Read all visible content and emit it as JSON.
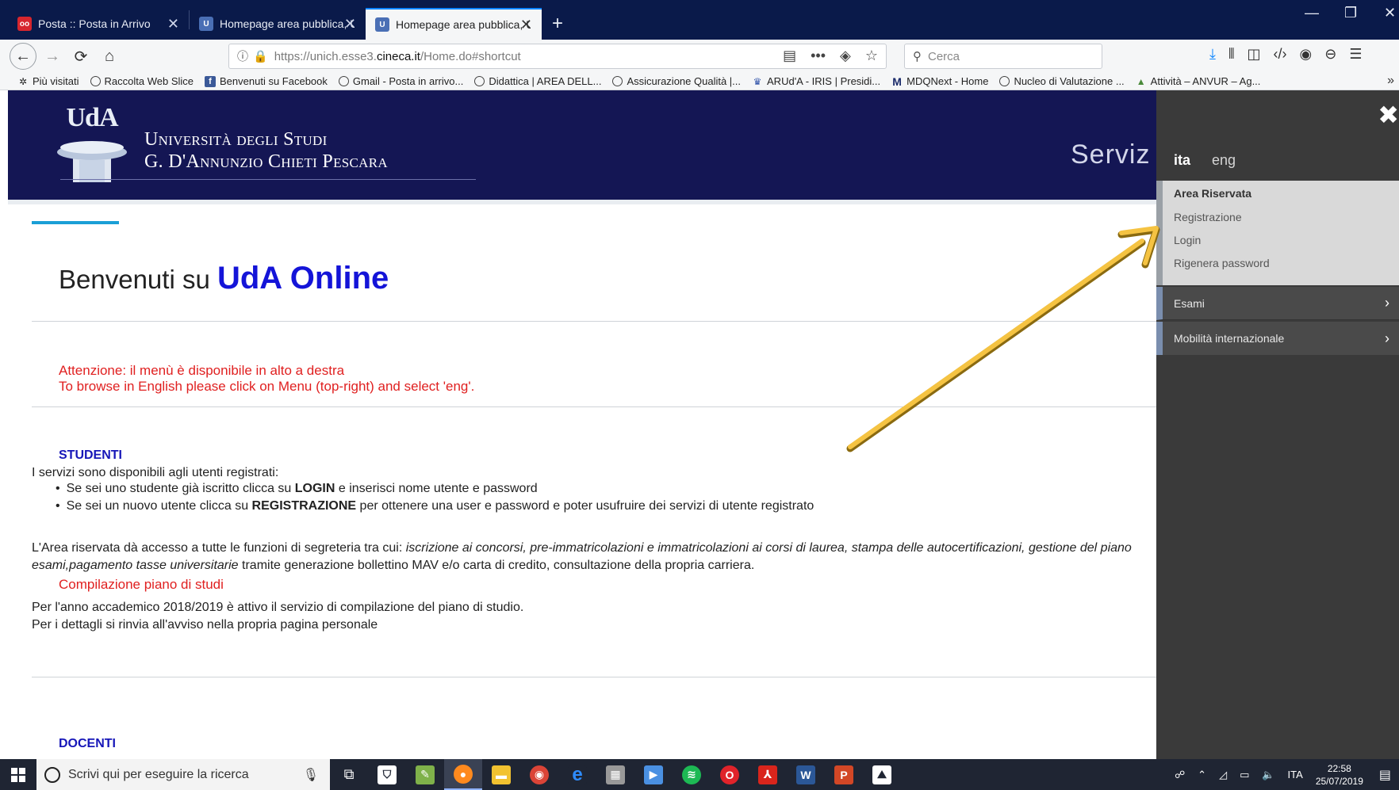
{
  "browser": {
    "tabs": [
      {
        "title": "Posta :: Posta in Arrivo",
        "active": false
      },
      {
        "title": "Homepage area pubblica, Univ",
        "active": false
      },
      {
        "title": "Homepage area pubblica, Univ",
        "active": true
      }
    ],
    "new_tab": "+",
    "url": {
      "prefix": "https://unich.esse3.",
      "host": "cineca.it",
      "path": "/Home.do#shortcut"
    },
    "search_placeholder": "Cerca",
    "bookmarks": [
      {
        "label": "Più visitati",
        "icon": "gear-icon"
      },
      {
        "label": "Raccolta Web Slice",
        "icon": "globe-icon"
      },
      {
        "label": "Benvenuti su Facebook",
        "icon": "facebook-icon"
      },
      {
        "label": "Gmail - Posta in arrivo...",
        "icon": "globe-icon"
      },
      {
        "label": "Didattica | AREA DELL...",
        "icon": "globe-icon"
      },
      {
        "label": "Assicurazione Qualità |...",
        "icon": "globe-icon"
      },
      {
        "label": "ARUd'A - IRIS | Presidi...",
        "icon": "uda-icon"
      },
      {
        "label": "MDQNext - Home",
        "icon": "m-icon"
      },
      {
        "label": "Nucleo di Valutazione ...",
        "icon": "globe-icon"
      },
      {
        "label": "Attività – ANVUR – Ag...",
        "icon": "anvur-icon"
      }
    ]
  },
  "header": {
    "logo_mark": "UdA",
    "university_line1": "Università degli Studi",
    "university_line2": "G. D'Annunzio Chieti Pescara",
    "servizi": "Serviz"
  },
  "main": {
    "welcome_prefix": "Benvenuti su ",
    "welcome_brand": "UdA Online",
    "alert_it": "Attenzione: il menù è disponibile in alto a destra",
    "alert_en": "To browse in English please click on Menu (top-right) and select 'eng'.",
    "studenti_title": "STUDENTI",
    "studenti_intro": "I servizi sono disponibili agli utenti registrati:",
    "bullet1_a": "Se sei uno studente già iscritto clicca su ",
    "bullet1_b": "LOGIN",
    "bullet1_c": " e inserisci nome utente e password",
    "bullet2_a": "Se sei un nuovo utente clicca su ",
    "bullet2_b": "REGISTRAZIONE",
    "bullet2_c": " per ottenere una user e password e poter usufruire dei servizi di utente registrato",
    "area_line1_a": "L'Area riservata dà accesso a tutte le funzioni di segreteria tra cui: ",
    "area_line1_b": "iscrizione ai concorsi, pre-immatricolazioni e immatricolazioni ai corsi di laurea, stampa delle autocertificazioni, gestione del piano",
    "area_line2_a": "esami,pagamento tasse universitarie",
    "area_line2_b": " tramite generazione bollettino MAV e/o carta di credito, consultazione della propria carriera.",
    "piano_title": "Compilazione piano di studi",
    "piano_line1": "Per l'anno accademico 2018/2019 è attivo il servizio di compilazione del piano di studio.",
    "piano_line2": "Per i dettagli si rinvia all'avviso nella propria pagina personale",
    "docenti_title": "DOCENTI"
  },
  "sidemenu": {
    "lang_active": "ita",
    "lang_other": "eng",
    "reserved_title": "Area Riservata",
    "reserved_items": [
      "Registrazione",
      "Login",
      "Rigenera password"
    ],
    "rows": [
      "Esami",
      "Mobilità internazionale"
    ]
  },
  "taskbar": {
    "search_placeholder": "Scrivi qui per eseguire la ricerca",
    "lang": "ITA",
    "time": "22:58",
    "date": "25/07/2019"
  }
}
